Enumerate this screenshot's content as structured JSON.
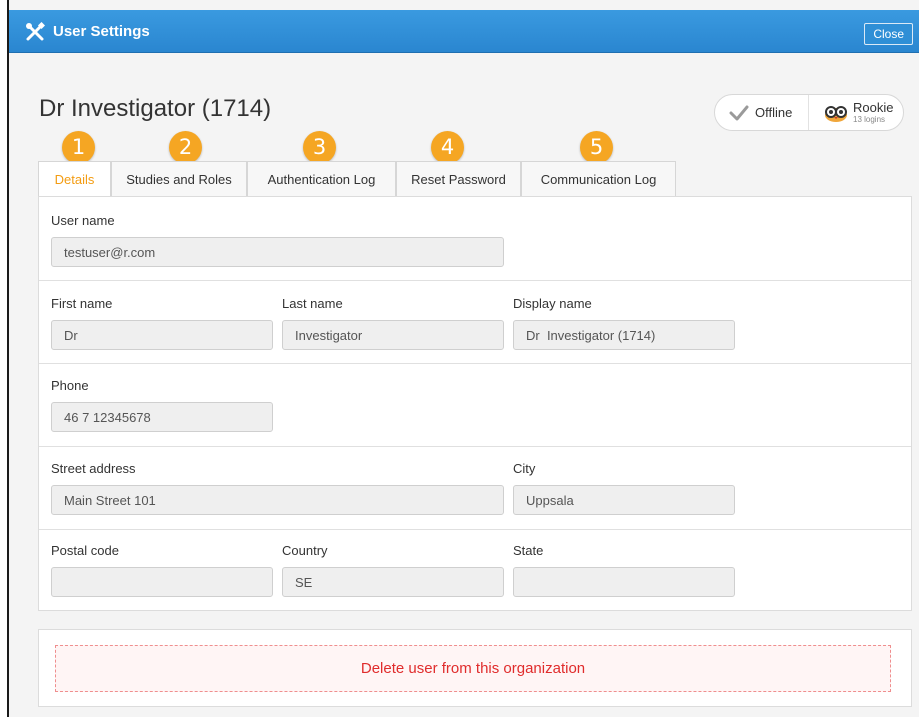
{
  "window": {
    "title": "User Settings",
    "close_label": "Close"
  },
  "user": {
    "heading": "Dr Investigator (1714)"
  },
  "status": {
    "online": "Offline",
    "level": "Rookie",
    "logins": "13 logins"
  },
  "badges": [
    "1",
    "2",
    "3",
    "4",
    "5"
  ],
  "tabs": [
    {
      "label": "Details",
      "active": true
    },
    {
      "label": "Studies and Roles"
    },
    {
      "label": "Authentication Log"
    },
    {
      "label": "Reset Password"
    },
    {
      "label": "Communication Log"
    }
  ],
  "fields": {
    "username": {
      "label": "User name",
      "value": "testuser@r.com"
    },
    "first_name": {
      "label": "First name",
      "value": "Dr"
    },
    "last_name": {
      "label": "Last name",
      "value": "Investigator"
    },
    "display_name": {
      "label": "Display name",
      "value": "Dr  Investigator (1714)"
    },
    "phone": {
      "label": "Phone",
      "value": "46 7 12345678"
    },
    "street": {
      "label": "Street address",
      "value": "Main Street 101"
    },
    "city": {
      "label": "City",
      "value": "Uppsala"
    },
    "postal_code": {
      "label": "Postal code",
      "value": ""
    },
    "country": {
      "label": "Country",
      "value": "SE"
    },
    "state": {
      "label": "State",
      "value": ""
    }
  },
  "actions": {
    "delete_label": "Delete user from this organization"
  },
  "colors": {
    "accent": "#f5a623",
    "titlebar": "#2a86d0",
    "danger": "#e02c2c",
    "tab_active": "#f39c12"
  },
  "icons": {
    "title": "tools-icon",
    "offline": "check-icon",
    "rookie": "owl-icon"
  }
}
